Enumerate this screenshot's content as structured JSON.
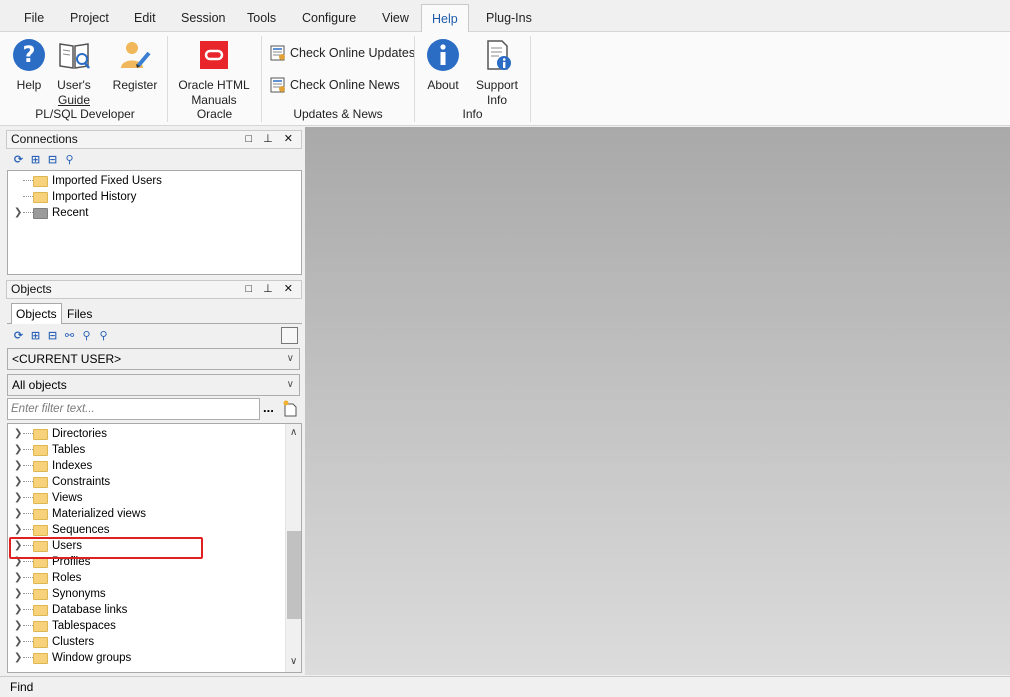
{
  "menubar": {
    "items": [
      "File",
      "Project",
      "Edit",
      "Session",
      "Tools",
      "Configure",
      "View",
      "Help",
      "Plug-Ins"
    ],
    "active": "Help"
  },
  "ribbon": {
    "help_label": "Help",
    "users_guide_line1": "User's",
    "users_guide_line2": "Guide",
    "register_label": "Register",
    "oracle_html_line1": "Oracle HTML",
    "oracle_html_line2": "Manuals",
    "check_updates_label": "Check Online Updates",
    "check_news_label": "Check Online News",
    "about_label": "About",
    "support_line1": "Support",
    "support_line2": "Info",
    "groups": {
      "plsql": "PL/SQL Developer",
      "oracle": "Oracle",
      "updates": "Updates & News",
      "info": "Info"
    }
  },
  "connections": {
    "title": "Connections",
    "header_buttons": "□ ⊥ ✕",
    "items": [
      {
        "label": "Imported Fixed Users"
      },
      {
        "label": "Imported History"
      },
      {
        "label": "Recent"
      }
    ]
  },
  "objects": {
    "title": "Objects",
    "header_buttons": "□ ⊥ ✕",
    "tabs": [
      "Objects",
      "Files"
    ],
    "user_select": "<CURRENT USER>",
    "type_select": "All objects",
    "filter_placeholder": "Enter filter text...",
    "filter_more": "...",
    "items": [
      {
        "label": "Directories"
      },
      {
        "label": "Tables"
      },
      {
        "label": "Indexes"
      },
      {
        "label": "Constraints"
      },
      {
        "label": "Views"
      },
      {
        "label": "Materialized views"
      },
      {
        "label": "Sequences"
      },
      {
        "label": "Users"
      },
      {
        "label": "Profiles"
      },
      {
        "label": "Roles"
      },
      {
        "label": "Synonyms"
      },
      {
        "label": "Database links"
      },
      {
        "label": "Tablespaces"
      },
      {
        "label": "Clusters"
      },
      {
        "label": "Window groups"
      }
    ]
  },
  "statusbar": {
    "find_label": "Find"
  }
}
